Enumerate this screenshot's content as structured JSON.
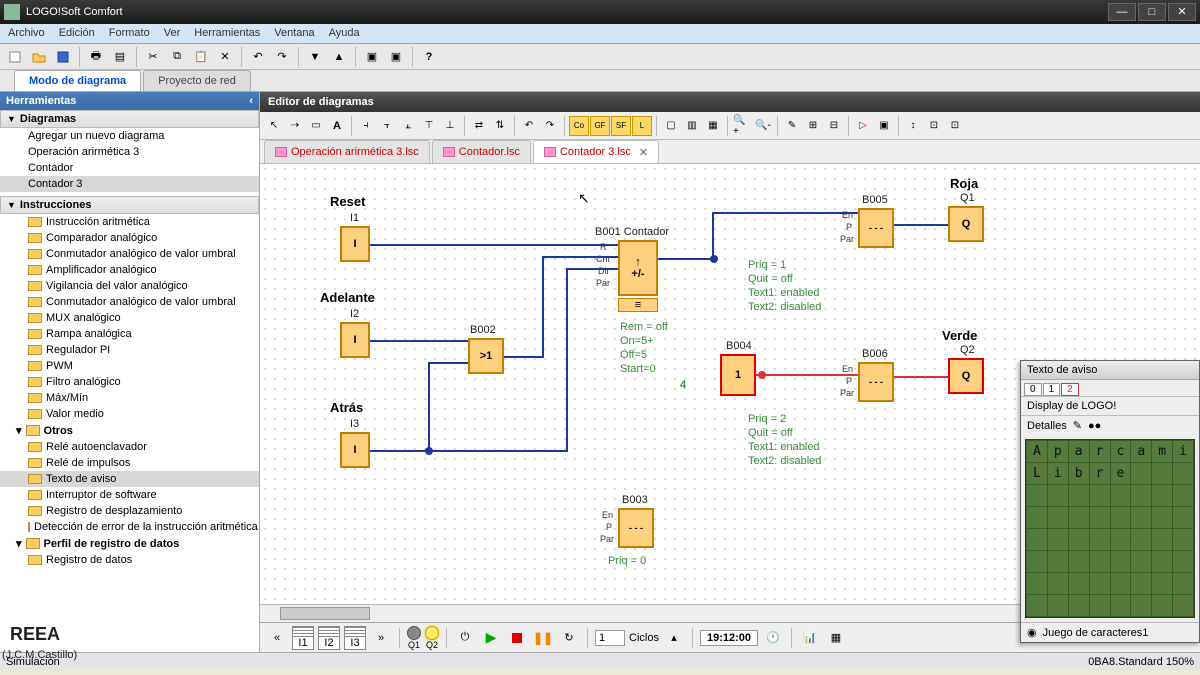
{
  "window": {
    "title": "LOGO!Soft Comfort"
  },
  "menu": [
    "Archivo",
    "Edición",
    "Formato",
    "Ver",
    "Herramientas",
    "Ventana",
    "Ayuda"
  ],
  "main_tabs": {
    "a": "Modo de diagrama",
    "b": "Proyecto de red"
  },
  "left": {
    "title": "Herramientas",
    "diagrams_hdr": "Diagramas",
    "diagrams": [
      "Agregar un nuevo diagrama",
      "Operación arirmética 3",
      "Contador",
      "Contador 3"
    ],
    "instr_hdr": "Instrucciones",
    "instr": [
      "Instrucción aritmética",
      "Comparador analógico",
      "Conmutador analógico de valor umbral",
      "Amplificador analógico",
      "Vigilancia del valor analógico",
      "Conmutador analógico de valor umbral",
      "MUX analógico",
      "Rampa analógica",
      "Regulador PI",
      "PWM",
      "Filtro analógico",
      "Máx/Mín",
      "Valor medio"
    ],
    "otros_hdr": "Otros",
    "otros": [
      "Relé autoenclavador",
      "Relé de impulsos",
      "Texto de aviso",
      "Interruptor de software",
      "Registro de desplazamiento",
      "Detección de error de la instrucción aritmética"
    ],
    "perfil_hdr": "Perfil de registro de datos",
    "perfil_item": "Registro de datos"
  },
  "editor": {
    "title": "Editor de diagramas",
    "file_tabs": [
      "Operación arirmética 3.lsc",
      "Contador.lsc",
      "Contador 3.lsc"
    ]
  },
  "diagram": {
    "i1": {
      "label": "Reset",
      "id": "I1",
      "sym": "I"
    },
    "i2": {
      "label": "Adelante",
      "id": "I2",
      "sym": "I"
    },
    "i3": {
      "label": "Atrás",
      "id": "I3",
      "sym": "I"
    },
    "b002": {
      "id": "B002",
      "sym": ">1"
    },
    "b001": {
      "id": "B001",
      "name": "Contador",
      "sym": "+/-",
      "pins": [
        "R",
        "Cnt",
        "Dir",
        "Par"
      ]
    },
    "b001_params": "Rem = off\nOn=5+\nOff=5\nStart=0",
    "b001_out": "4",
    "b004": {
      "id": "B004",
      "sym": "1"
    },
    "b003": {
      "id": "B003",
      "pins": [
        "En",
        "P",
        "Par"
      ]
    },
    "b003_params": "Priq = 0",
    "b005": {
      "id": "B005",
      "pins": [
        "En",
        "P",
        "Par"
      ]
    },
    "b005_params": "Priq = 1\nQuit = off\nText1: enabled\nText2: disabled",
    "b006": {
      "id": "B006",
      "pins": [
        "En",
        "P",
        "Par"
      ]
    },
    "b006_params": "Priq = 2\nQuit = off\nText1: enabled\nText2: disabled",
    "q1": {
      "label": "Roja",
      "id": "Q1",
      "sym": "Q"
    },
    "q2": {
      "label": "Verde",
      "id": "Q2",
      "sym": "Q"
    }
  },
  "aviso": {
    "title": "Texto de aviso",
    "display": "Display de LOGO!",
    "detalles": "Detalles",
    "row1": [
      "A",
      "p",
      "a",
      "r",
      "c",
      "a",
      "m",
      "i"
    ],
    "row2": [
      "L",
      "i",
      "b",
      "r",
      "e",
      "",
      "",
      ""
    ],
    "footer": "Juego de caracteres1"
  },
  "sim": {
    "ios": [
      "I1",
      "I2",
      "I3"
    ],
    "qs": [
      "Q1",
      "Q2"
    ],
    "cycles_lbl": "Ciclos",
    "cycles_val": "1",
    "time": "19:12:00"
  },
  "status": {
    "left": "Simulación",
    "right": "0BA8.Standard 150%"
  },
  "watermark": {
    "l1": "REEA",
    "l2": "(J.C.M.Castillo)"
  }
}
